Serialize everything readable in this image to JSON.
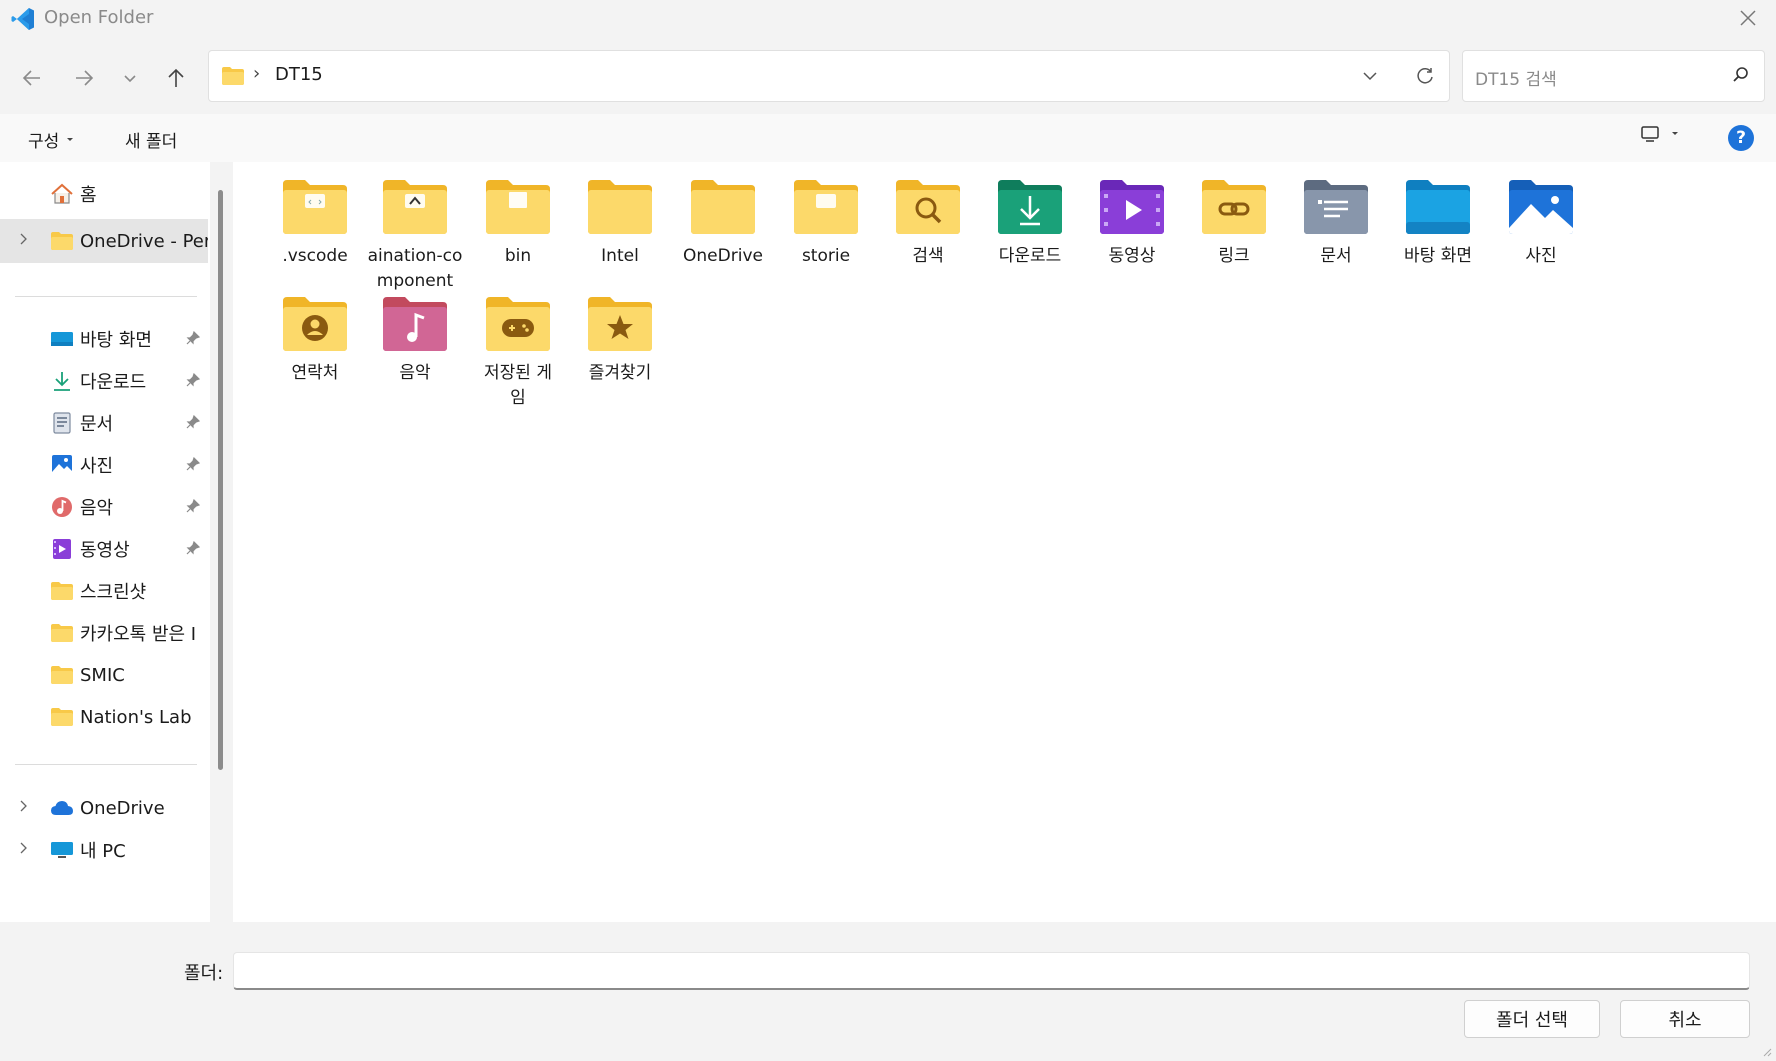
{
  "window": {
    "title": "Open Folder"
  },
  "address": {
    "path_segment": "DT15"
  },
  "search": {
    "placeholder": "DT15 검색"
  },
  "command_bar": {
    "organize_label": "구성",
    "new_folder_label": "새 폴더",
    "help_label": "?"
  },
  "sidebar": {
    "home": "홈",
    "onedrive_personal": "OneDrive - Pers",
    "quick_access": [
      {
        "label": "바탕 화면",
        "icon": "desktop-icon",
        "pinned": true
      },
      {
        "label": "다운로드",
        "icon": "download-icon",
        "pinned": true
      },
      {
        "label": "문서",
        "icon": "documents-icon",
        "pinned": true
      },
      {
        "label": "사진",
        "icon": "pictures-icon",
        "pinned": true
      },
      {
        "label": "음악",
        "icon": "music-icon",
        "pinned": true
      },
      {
        "label": "동영상",
        "icon": "videos-icon",
        "pinned": true
      },
      {
        "label": "스크린샷",
        "icon": "folder-icon",
        "pinned": false
      },
      {
        "label": "카카오톡 받은 I",
        "icon": "folder-icon",
        "pinned": false
      },
      {
        "label": "SMIC",
        "icon": "folder-icon",
        "pinned": false
      },
      {
        "label": "Nation's Lab",
        "icon": "folder-icon",
        "pinned": false
      }
    ],
    "onedrive": "OneDrive",
    "this_pc": "내 PC"
  },
  "items": [
    {
      "label": ".vscode",
      "icon": "folder-vscode-icon"
    },
    {
      "label": "aination-component",
      "display": "aination-co\nmponent",
      "icon": "folder-aination-icon"
    },
    {
      "label": "bin",
      "icon": "folder-bin-icon"
    },
    {
      "label": "Intel",
      "icon": "folder-icon"
    },
    {
      "label": "OneDrive",
      "icon": "folder-icon"
    },
    {
      "label": "storie",
      "icon": "folder-storie-icon"
    },
    {
      "label": "검색",
      "icon": "search-folder-icon"
    },
    {
      "label": "다운로드",
      "icon": "downloads-folder-icon"
    },
    {
      "label": "동영상",
      "icon": "videos-folder-icon"
    },
    {
      "label": "링크",
      "icon": "links-folder-icon"
    },
    {
      "label": "문서",
      "icon": "documents-folder-icon"
    },
    {
      "label": "바탕 화면",
      "icon": "desktop-folder-icon"
    },
    {
      "label": "사진",
      "icon": "pictures-folder-icon"
    },
    {
      "label": "연락처",
      "icon": "contacts-folder-icon"
    },
    {
      "label": "음악",
      "icon": "music-folder-icon"
    },
    {
      "label": "저장된 게임",
      "display": "저장된 게\n임",
      "icon": "saved-games-folder-icon"
    },
    {
      "label": "즐겨찾기",
      "icon": "favorites-folder-icon"
    }
  ],
  "footer": {
    "folder_label": "폴더:",
    "folder_value": "",
    "select_button": "폴더 선택",
    "cancel_button": "취소"
  },
  "colors": {
    "folder_yellow": "#f8c948",
    "accent_blue": "#1e73d9",
    "downloads_teal": "#1aa179",
    "videos_purple": "#8a3ed8",
    "documents_gray": "#7d8a9e",
    "desktop_blue": "#1597d8"
  }
}
